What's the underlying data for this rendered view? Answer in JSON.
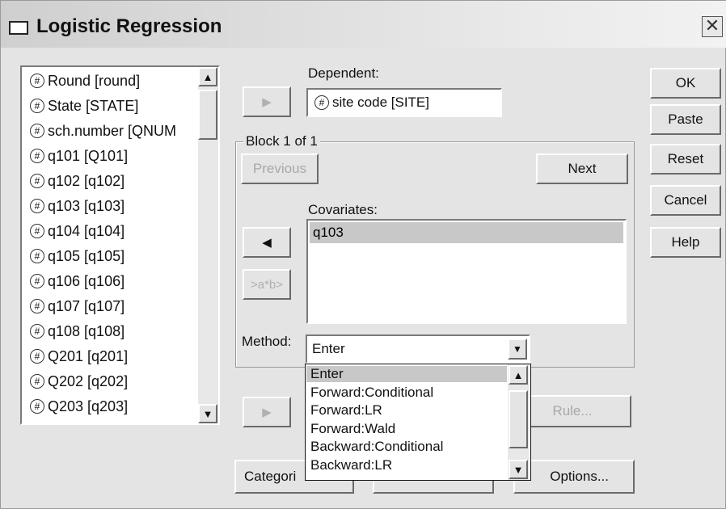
{
  "window": {
    "title": "Logistic Regression",
    "close_glyph": "✕"
  },
  "variables": [
    {
      "label": "Round [round]"
    },
    {
      "label": "State [STATE]"
    },
    {
      "label": "sch.number [QNUM"
    },
    {
      "label": "q101 [Q101]"
    },
    {
      "label": "q102 [q102]"
    },
    {
      "label": "q103 [q103]"
    },
    {
      "label": "q104 [q104]"
    },
    {
      "label": "q105 [q105]"
    },
    {
      "label": "q106 [q106]"
    },
    {
      "label": "q107 [q107]"
    },
    {
      "label": "q108 [q108]"
    },
    {
      "label": "Q201 [q201]"
    },
    {
      "label": "Q202 [q202]"
    },
    {
      "label": "Q203 [q203]"
    }
  ],
  "var_icon_glyph": "#",
  "dependent": {
    "label": "Dependent:",
    "value": "site code [SITE]"
  },
  "block": {
    "label": "Block 1 of 1",
    "previous": "Previous",
    "next": "Next"
  },
  "covariates": {
    "label": "Covariates:",
    "items": [
      "q103"
    ]
  },
  "interaction_button": ">a*b>",
  "method": {
    "label": "Method:",
    "selected": "Enter",
    "options": [
      "Enter",
      "Forward:Conditional",
      "Forward:LR",
      "Forward:Wald",
      "Backward:Conditional",
      "Backward:LR"
    ]
  },
  "right_buttons": {
    "ok": "OK",
    "paste": "Paste",
    "reset": "Reset",
    "cancel": "Cancel",
    "help": "Help"
  },
  "bottom_buttons": {
    "categorical": "Categori",
    "rule": "Rule...",
    "options": "Options..."
  },
  "arrows": {
    "right": "▶",
    "left": "◀",
    "up": "▲",
    "down": "▼"
  },
  "colors": {
    "dialog_bg": "#e4e4e4",
    "selection": "#c8c8c8",
    "disabled_text": "#a8a8a8"
  }
}
